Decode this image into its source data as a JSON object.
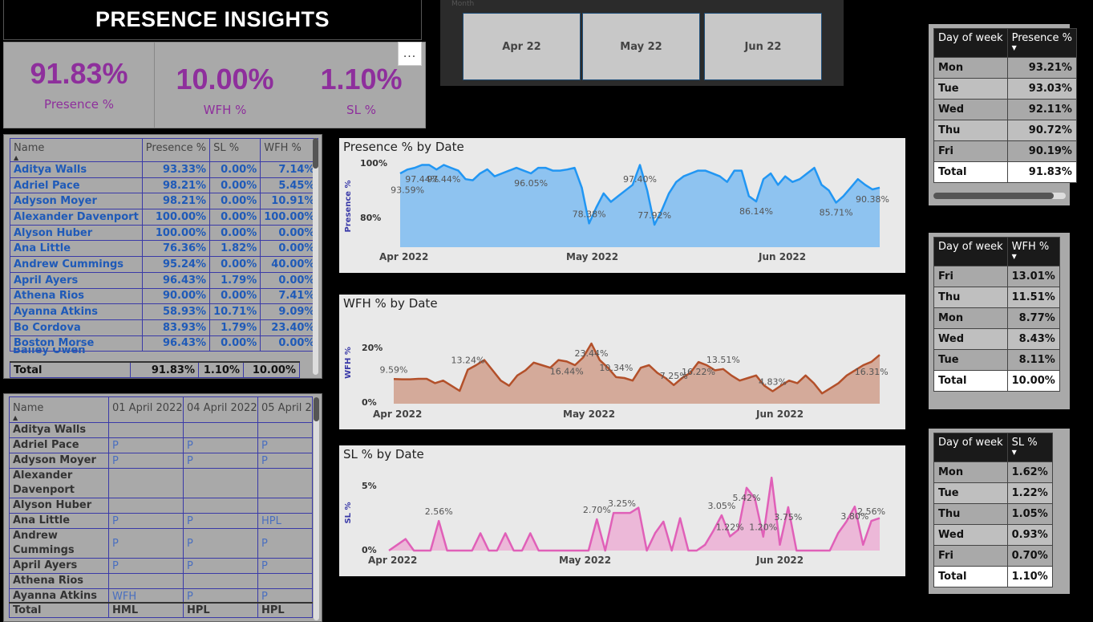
{
  "header": {
    "title": "PRESENCE INSIGHTS"
  },
  "kpis": [
    {
      "value": "91.83%",
      "label": "Presence %"
    },
    {
      "value": "10.00%",
      "label": "WFH %"
    },
    {
      "value": "1.10%",
      "label": "SL %"
    }
  ],
  "more_button": "...",
  "slicer": {
    "header": "Month",
    "items": [
      "Apr 22",
      "May 22",
      "Jun 22"
    ]
  },
  "employee_table": {
    "columns": [
      "Name",
      "Presence %",
      "SL %",
      "WFH %"
    ],
    "rows": [
      [
        "Aditya Walls",
        "93.33%",
        "0.00%",
        "7.14%"
      ],
      [
        "Adriel Pace",
        "98.21%",
        "0.00%",
        "5.45%"
      ],
      [
        "Adyson Moyer",
        "98.21%",
        "0.00%",
        "10.91%"
      ],
      [
        "Alexander Davenport",
        "100.00%",
        "0.00%",
        "100.00%"
      ],
      [
        "Alyson Huber",
        "100.00%",
        "0.00%",
        "0.00%"
      ],
      [
        "Ana Little",
        "76.36%",
        "1.82%",
        "0.00%"
      ],
      [
        "Andrew Cummings",
        "95.24%",
        "0.00%",
        "40.00%"
      ],
      [
        "April Ayers",
        "96.43%",
        "1.79%",
        "0.00%"
      ],
      [
        "Athena Rios",
        "90.00%",
        "0.00%",
        "7.41%"
      ],
      [
        "Ayanna Atkins",
        "58.93%",
        "10.71%",
        "9.09%"
      ],
      [
        "Bo Cordova",
        "83.93%",
        "1.79%",
        "23.40%"
      ],
      [
        "Boston Morse",
        "96.43%",
        "0.00%",
        "0.00%"
      ]
    ],
    "total": [
      "Total",
      "91.83%",
      "1.10%",
      "10.00%"
    ]
  },
  "attendance_table": {
    "columns": [
      "Name",
      "01 April 2022",
      "04 April 2022",
      "05 April 20"
    ],
    "rows": [
      [
        "Aditya Walls",
        "",
        "",
        ""
      ],
      [
        "Adriel Pace",
        "P",
        "P",
        "P"
      ],
      [
        "Adyson Moyer",
        "P",
        "P",
        "P"
      ],
      [
        "Alexander Davenport",
        "",
        "",
        ""
      ],
      [
        "Alyson Huber",
        "",
        "",
        ""
      ],
      [
        "Ana Little",
        "P",
        "P",
        "HPL"
      ],
      [
        "Andrew Cummings",
        "P",
        "P",
        "P"
      ],
      [
        "April Ayers",
        "P",
        "P",
        "P"
      ],
      [
        "Athena Rios",
        "",
        "",
        ""
      ],
      [
        "Ayanna Atkins",
        "WFH",
        "P",
        "P"
      ]
    ],
    "total": [
      "Total",
      "HML",
      "HPL",
      "HPL"
    ]
  },
  "presence_by_day": {
    "columns": [
      "Day of week",
      "Presence %"
    ],
    "rows": [
      [
        "Mon",
        "93.21%"
      ],
      [
        "Tue",
        "93.03%"
      ],
      [
        "Wed",
        "92.11%"
      ],
      [
        "Thu",
        "90.72%"
      ],
      [
        "Fri",
        "90.19%"
      ]
    ],
    "total": [
      "Total",
      "91.83%"
    ]
  },
  "wfh_by_day": {
    "columns": [
      "Day of week",
      "WFH %"
    ],
    "rows": [
      [
        "Fri",
        "13.01%"
      ],
      [
        "Thu",
        "11.51%"
      ],
      [
        "Mon",
        "8.77%"
      ],
      [
        "Wed",
        "8.43%"
      ],
      [
        "Tue",
        "8.11%"
      ]
    ],
    "total": [
      "Total",
      "10.00%"
    ]
  },
  "sl_by_day": {
    "columns": [
      "Day of week",
      "SL %"
    ],
    "rows": [
      [
        "Mon",
        "1.62%"
      ],
      [
        "Tue",
        "1.22%"
      ],
      [
        "Thu",
        "1.05%"
      ],
      [
        "Wed",
        "0.93%"
      ],
      [
        "Fri",
        "0.70%"
      ]
    ],
    "total": [
      "Total",
      "1.10%"
    ]
  },
  "colors": {
    "presence": "#2196f3",
    "presence_fill": "#8ec3f0",
    "wfh": "#b3502a",
    "wfh_fill": "#d4aa9a",
    "sl": "#e060b8",
    "sl_fill": "#ecb8d8",
    "kpi": "#8e2f9c"
  },
  "chart_data": [
    {
      "type": "area",
      "title": "Presence % by Date",
      "ylabel": "Presence %",
      "xticks": [
        "Apr 2022",
        "May 2022",
        "Jun 2022"
      ],
      "yticks": [
        "100%",
        "80%"
      ],
      "ylim": [
        70,
        100
      ],
      "values": [
        96,
        97.4,
        98,
        99,
        99,
        97.4,
        99,
        98,
        97,
        94,
        93.6,
        96,
        97.44,
        95,
        96,
        97,
        98,
        97,
        96.05,
        98,
        98,
        97,
        97,
        97.4,
        98,
        91,
        78.38,
        84,
        89,
        86,
        88,
        90,
        92,
        99,
        90,
        77.92,
        83,
        89,
        93,
        95,
        96,
        97,
        97,
        96,
        95,
        93,
        97,
        97,
        88,
        86.14,
        94,
        96,
        92,
        95,
        93,
        94,
        96,
        98,
        92,
        90,
        85.71,
        88,
        91,
        94,
        92,
        90.38,
        91
      ],
      "labels": [
        {
          "i": 3,
          "v": 97.44,
          "t": "97.44%"
        },
        {
          "i": 1,
          "v": 93.59,
          "t": "93.59%"
        },
        {
          "i": 6,
          "v": 97.44,
          "t": "97.44%"
        },
        {
          "i": 18,
          "v": 96.05,
          "t": "96.05%"
        },
        {
          "i": 26,
          "v": 78.38,
          "t": "78.38%"
        },
        {
          "i": 33,
          "v": 97.4,
          "t": "97.40%"
        },
        {
          "i": 35,
          "v": 77.92,
          "t": "77.92%"
        },
        {
          "i": 49,
          "v": 86.14,
          "t": "86.14%"
        },
        {
          "i": 60,
          "v": 85.71,
          "t": "85.71%"
        },
        {
          "i": 65,
          "v": 90.38,
          "t": "90.38%"
        }
      ]
    },
    {
      "type": "area",
      "title": "WFH % by Date",
      "ylabel": "WFH %",
      "xticks": [
        "Apr 2022",
        "May 2022",
        "Jun 2022"
      ],
      "yticks": [
        "20%",
        "0%"
      ],
      "ylim": [
        0,
        30
      ],
      "values": [
        9.59,
        9.5,
        9.5,
        9.7,
        9.7,
        8,
        9,
        7,
        5,
        13.24,
        15,
        17,
        13,
        9,
        7,
        11,
        13,
        16,
        15,
        14,
        17,
        16.44,
        15,
        18,
        23.44,
        17,
        14,
        10.34,
        10,
        9,
        14,
        15,
        12,
        10,
        7.25,
        10,
        12,
        16.22,
        15,
        13,
        13.51,
        11,
        9,
        10,
        11,
        7,
        4.83,
        7,
        9,
        8,
        11,
        8,
        4,
        6,
        8,
        11,
        13,
        15,
        16.31,
        19
      ],
      "labels": [
        {
          "i": 0,
          "v": 9.59,
          "t": "9.59%"
        },
        {
          "i": 9,
          "v": 13.24,
          "t": "13.24%"
        },
        {
          "i": 21,
          "v": 16.44,
          "t": "16.44%"
        },
        {
          "i": 24,
          "v": 23.44,
          "t": "23.44%"
        },
        {
          "i": 27,
          "v": 10.34,
          "t": "10.34%"
        },
        {
          "i": 34,
          "v": 7.25,
          "t": "7.25%"
        },
        {
          "i": 37,
          "v": 16.22,
          "t": "16.22%"
        },
        {
          "i": 40,
          "v": 13.51,
          "t": "13.51%"
        },
        {
          "i": 46,
          "v": 4.83,
          "t": "4.83%"
        },
        {
          "i": 58,
          "v": 16.31,
          "t": "16.31%"
        }
      ]
    },
    {
      "type": "area",
      "title": "SL % by Date",
      "ylabel": "SL %",
      "xticks": [
        "Apr 2022",
        "May 2022",
        "Jun 2022"
      ],
      "yticks": [
        "5%",
        "0%"
      ],
      "ylim": [
        0,
        7
      ],
      "values": [
        0,
        0.5,
        1,
        0,
        0,
        0,
        2.56,
        0,
        0,
        0,
        0,
        1.5,
        0,
        0,
        1.5,
        0,
        0,
        1.5,
        0,
        0,
        0,
        0,
        0,
        0,
        0,
        2.7,
        0,
        3.25,
        3.25,
        3.25,
        3.7,
        0,
        1.5,
        2.5,
        0,
        2.8,
        0,
        0,
        0.5,
        1.7,
        3.05,
        1.22,
        1.8,
        5.42,
        4.5,
        1.2,
        6.3,
        0.5,
        3.75,
        0,
        0,
        0,
        0,
        0,
        1.5,
        2.5,
        3.8,
        0.5,
        2.56,
        2.8
      ],
      "labels": [
        {
          "i": 6,
          "v": 2.56,
          "t": "2.56%"
        },
        {
          "i": 25,
          "v": 2.7,
          "t": "2.70%"
        },
        {
          "i": 28,
          "v": 3.25,
          "t": "3.25%"
        },
        {
          "i": 40,
          "v": 3.05,
          "t": "3.05%"
        },
        {
          "i": 41,
          "v": 1.22,
          "t": "1.22%"
        },
        {
          "i": 43,
          "v": 5.42,
          "t": "5.42%"
        },
        {
          "i": 45,
          "v": 1.2,
          "t": "1.20%"
        },
        {
          "i": 48,
          "v": 3.75,
          "t": "3.75%"
        },
        {
          "i": 56,
          "v": 3.8,
          "t": "3.80%"
        },
        {
          "i": 58,
          "v": 2.56,
          "t": "2.56%"
        }
      ]
    }
  ]
}
